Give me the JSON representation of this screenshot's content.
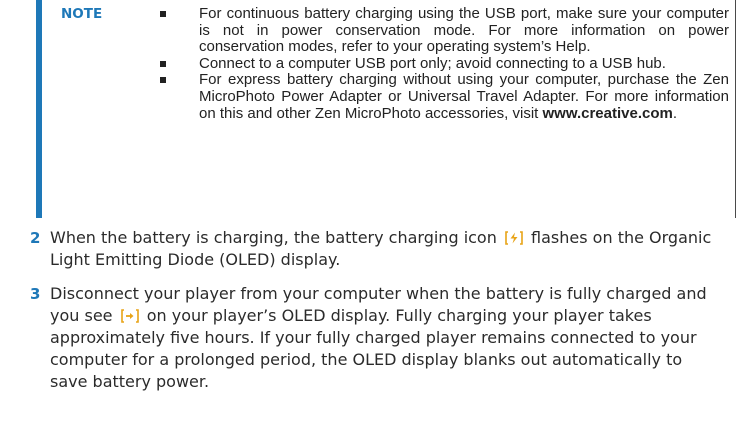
{
  "note": {
    "label": "NOTE",
    "items": [
      {
        "text": "For continuous battery charging using the USB port, make sure your computer is not in power conservation mode. For more information on power conservation modes, refer to your operating system’s Help."
      },
      {
        "text": "Connect to a computer USB port only; avoid connecting to a USB hub."
      },
      {
        "text_before": "For express battery charging without using your computer, purchase the Zen MicroPhoto Power Adapter or Universal Travel Adapter. For more information on this and other Zen MicroPhoto accessories, visit ",
        "link": "www.creative.com",
        "text_after": "."
      }
    ]
  },
  "steps": [
    {
      "number": "2",
      "text_before_icon": "When the battery is charging, the battery charging icon",
      "icon": "battery-charging-icon",
      "text_after_icon": "flashes on the Organic Light Emitting Diode (OLED) display."
    },
    {
      "number": "3",
      "text_before_icon": "Disconnect your player from your computer when the battery is fully charged and you see",
      "icon": "battery-full-icon",
      "text_after_icon": "on your player’s OLED display. Fully charging your player takes approximately five hours. If your fully charged player remains connected to your computer for a prolonged period, the OLED display blanks out automatically to save battery power."
    }
  ],
  "colors": {
    "accent": "#1e78b8",
    "text": "#2b2b2b",
    "icon": "#e8a317"
  }
}
